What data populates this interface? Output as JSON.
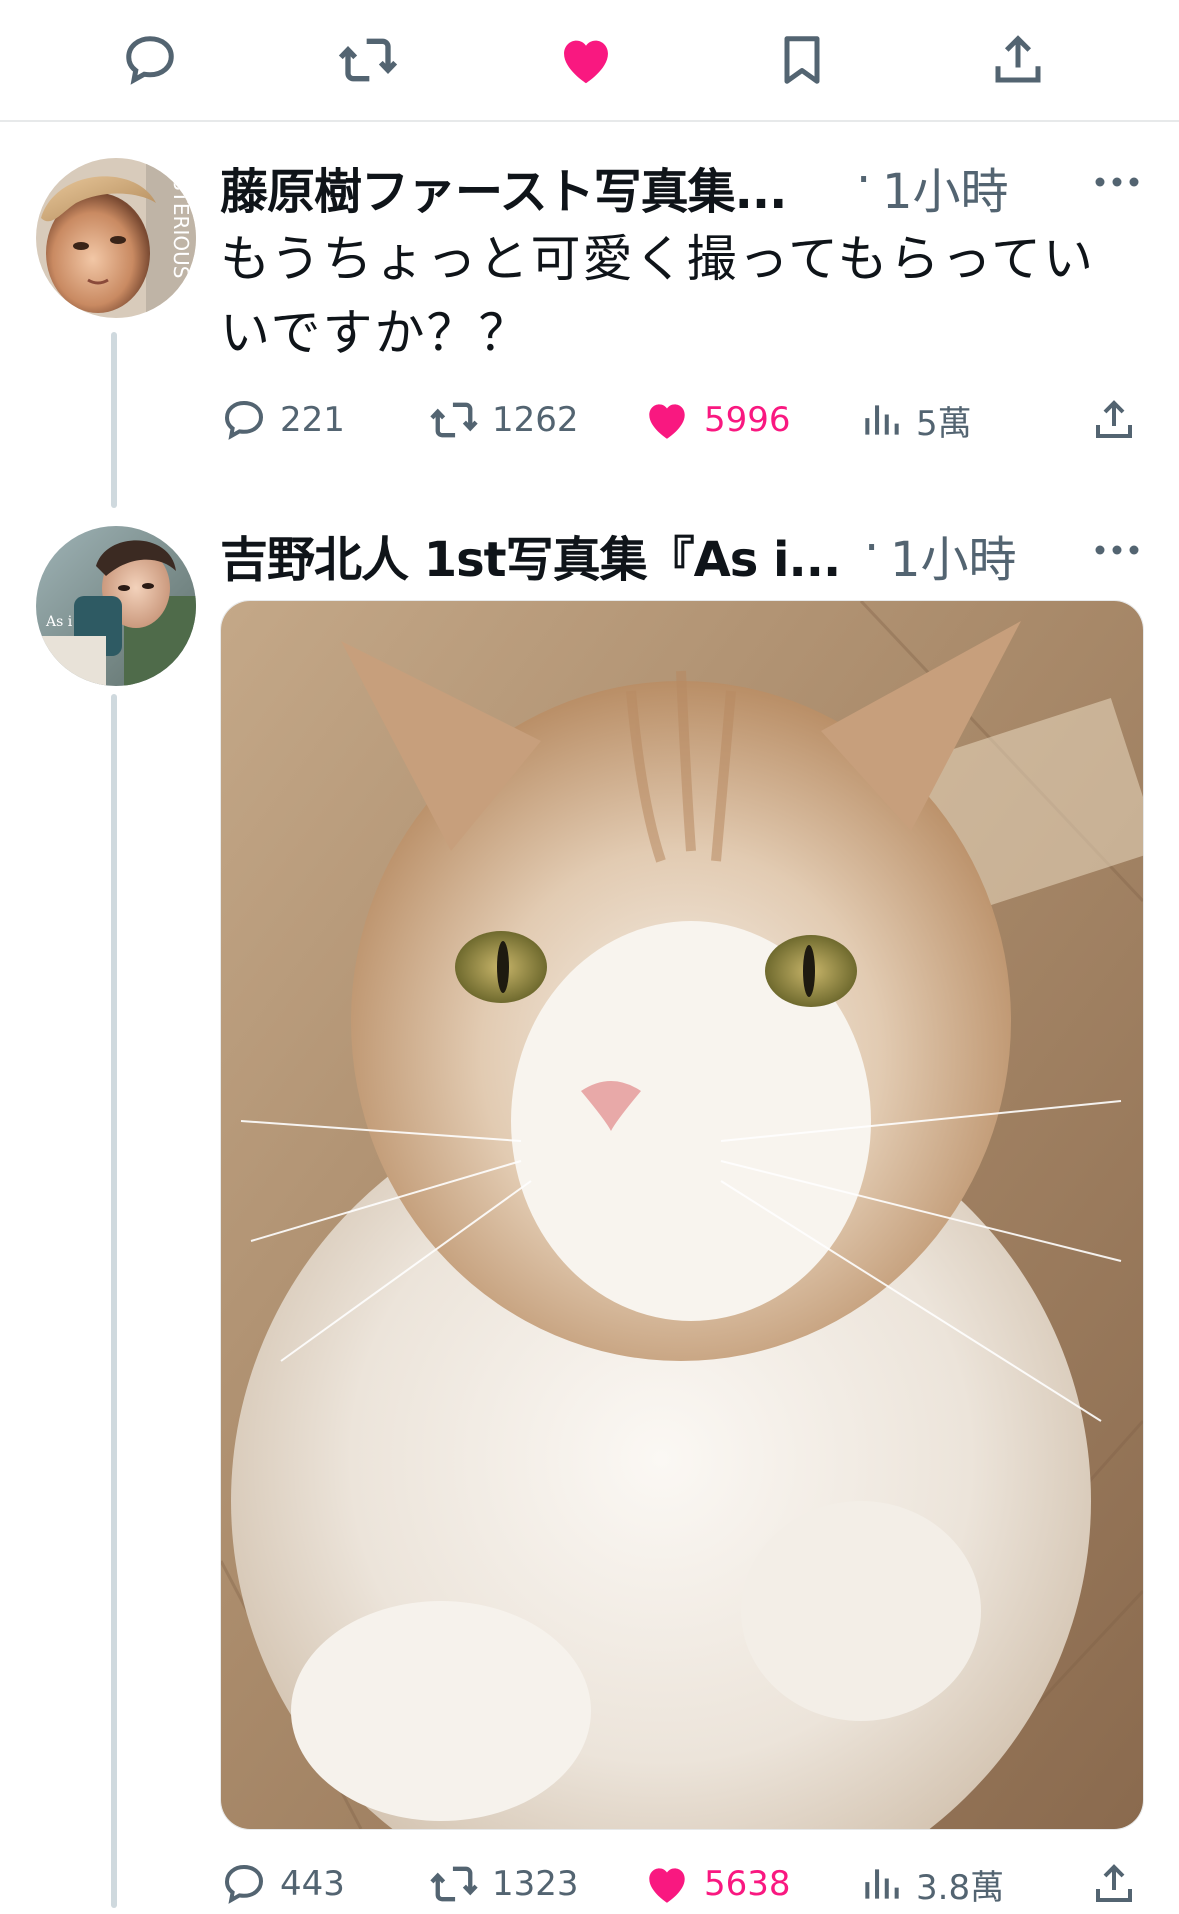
{
  "top_actions": {
    "icons": [
      "reply-icon",
      "retweet-icon",
      "like-icon-filled",
      "bookmark-icon",
      "share-icon"
    ],
    "like_color": "#f91880"
  },
  "tweets": [
    {
      "author": "藤原樹ファースト写真集...",
      "separator": "·",
      "time": "1小時",
      "text_line1": "もうちょっと可愛く撮ってもらってい",
      "text_line2": "いですか？？",
      "avatar_text": "STERIOUS",
      "metrics": {
        "replies": "221",
        "retweets": "1262",
        "likes": "5996",
        "views": "5萬"
      }
    },
    {
      "author": "吉野北人 1st写真集『As i...",
      "separator": "·",
      "time": "1小時",
      "avatar_text": "As i",
      "metrics": {
        "replies": "443",
        "retweets": "1323",
        "likes": "5638",
        "views": "3.8萬"
      }
    }
  ],
  "colors": {
    "text": "#0f1419",
    "muted": "#536471",
    "like": "#f91880",
    "divider": "#e7e9ea",
    "thread": "#cfd9de"
  }
}
